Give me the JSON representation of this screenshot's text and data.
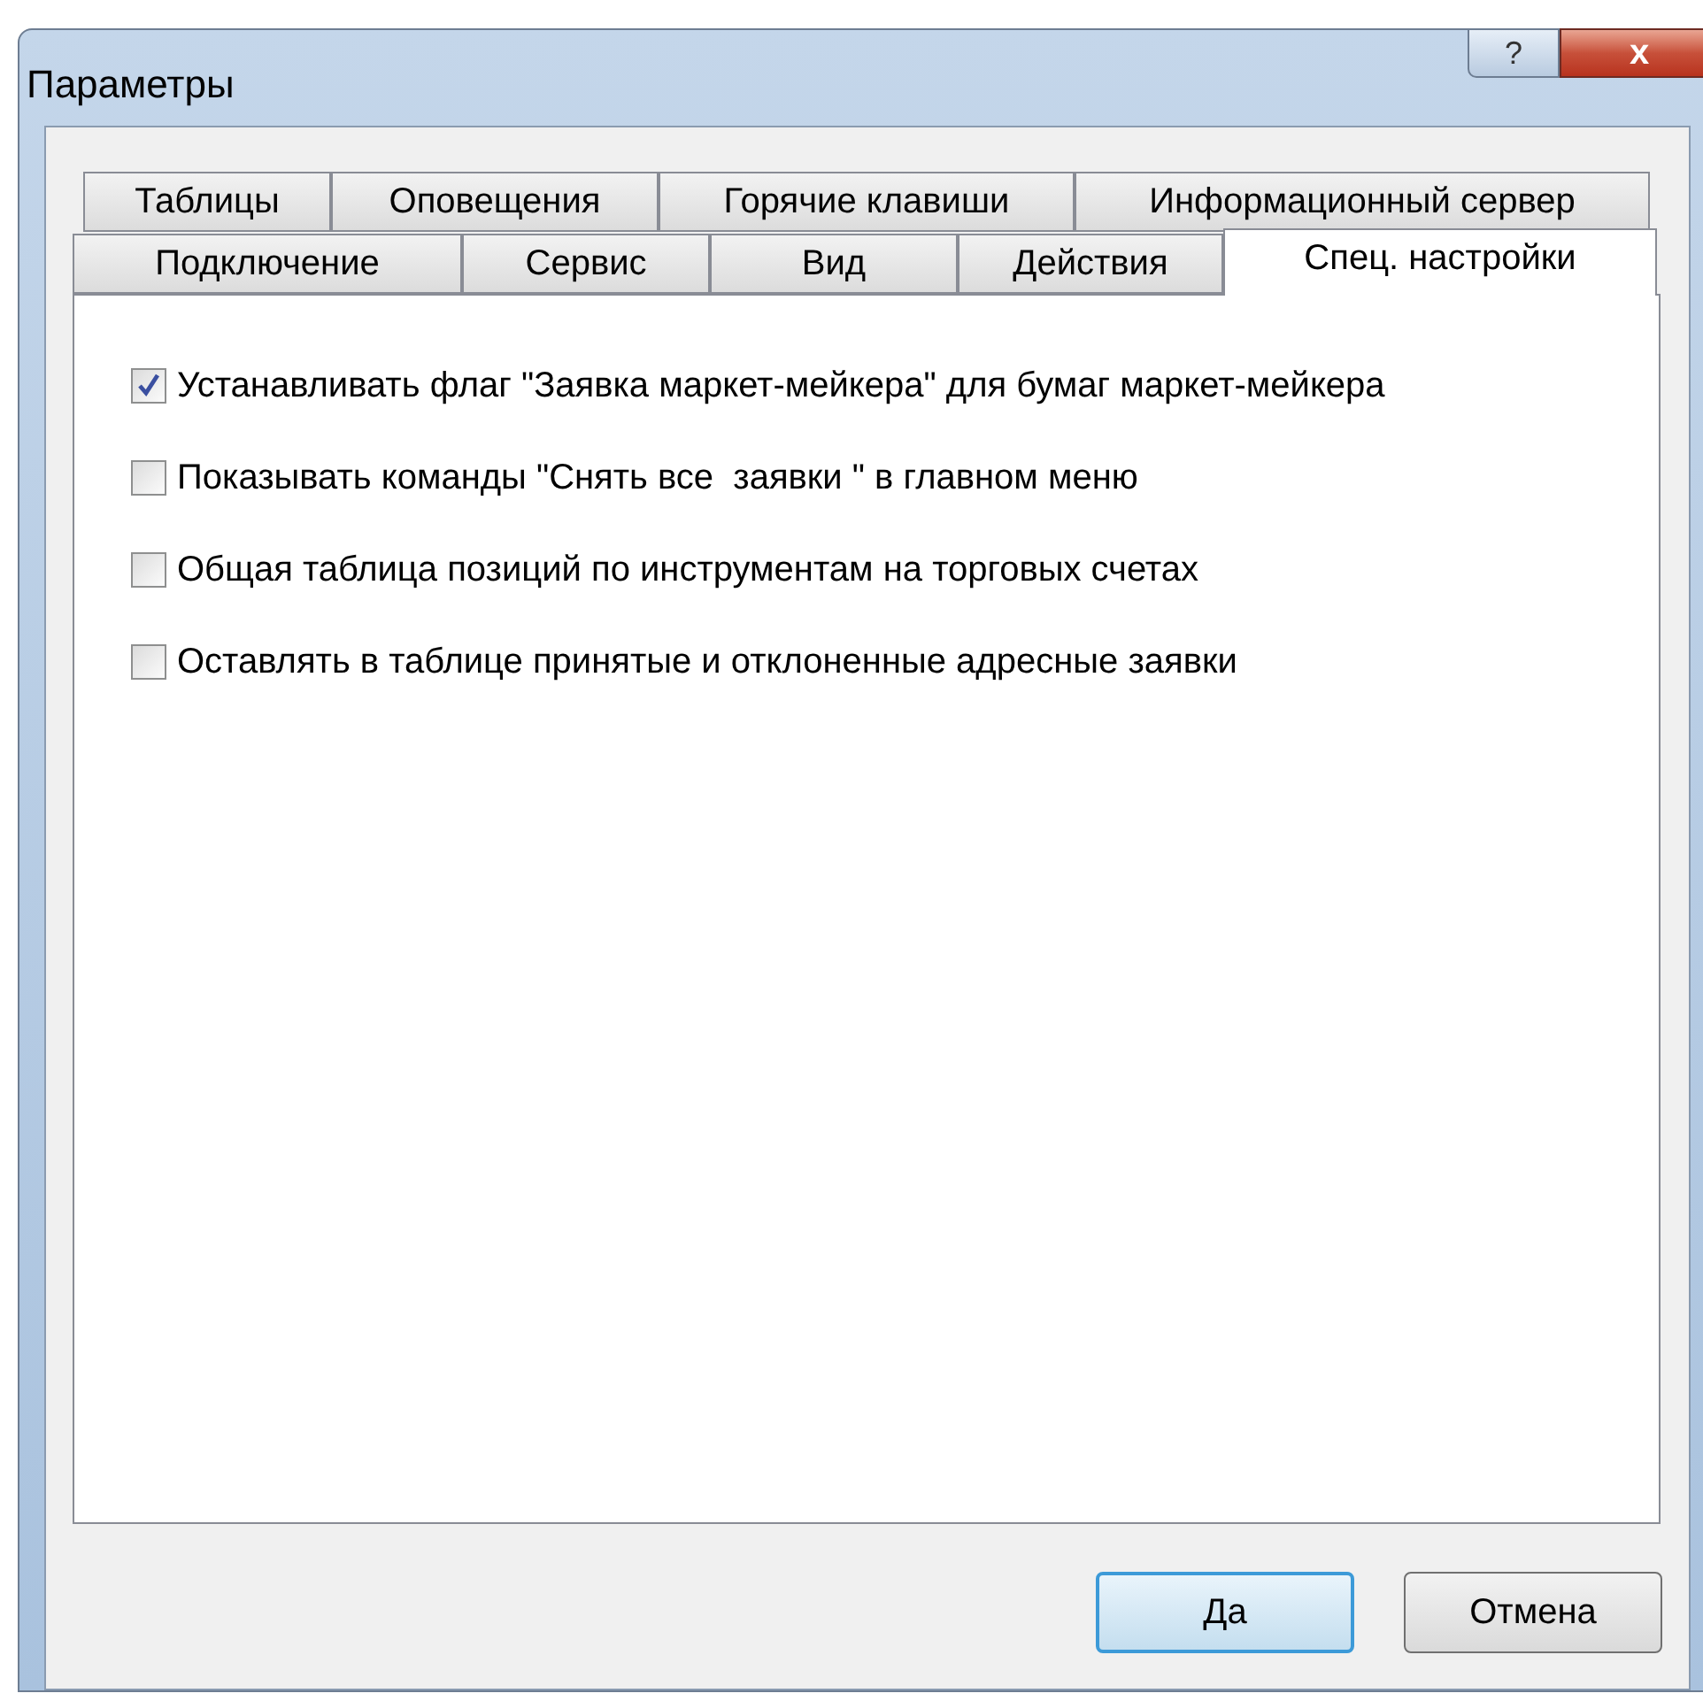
{
  "window": {
    "title": "Параметры",
    "help_button": "?",
    "close_button": "x"
  },
  "tab_rows": [
    [
      {
        "label": "Таблицы",
        "selected": false
      },
      {
        "label": "Оповещения",
        "selected": false
      },
      {
        "label": "Горячие клавиши",
        "selected": false
      },
      {
        "label": "Информационный сервер",
        "selected": false
      }
    ],
    [
      {
        "label": "Подключение",
        "selected": false
      },
      {
        "label": "Сервис",
        "selected": false
      },
      {
        "label": "Вид",
        "selected": false
      },
      {
        "label": "Действия",
        "selected": false
      },
      {
        "label": "Спец. настройки",
        "selected": true
      }
    ]
  ],
  "options": [
    {
      "label": "Устанавливать флаг \"Заявка маркет-мейкера\" для бумаг маркет-мейкера",
      "checked": true
    },
    {
      "label": "Показывать команды \"Снять все  заявки \" в главном меню",
      "checked": false
    },
    {
      "label": "Общая таблица позиций по инструментам на торговых счетах",
      "checked": false
    },
    {
      "label": "Оставлять в таблице принятые и отклоненные адресные заявки",
      "checked": false
    }
  ],
  "buttons": [
    {
      "label": "Да",
      "default": true
    },
    {
      "label": "Отмена",
      "default": false
    }
  ]
}
